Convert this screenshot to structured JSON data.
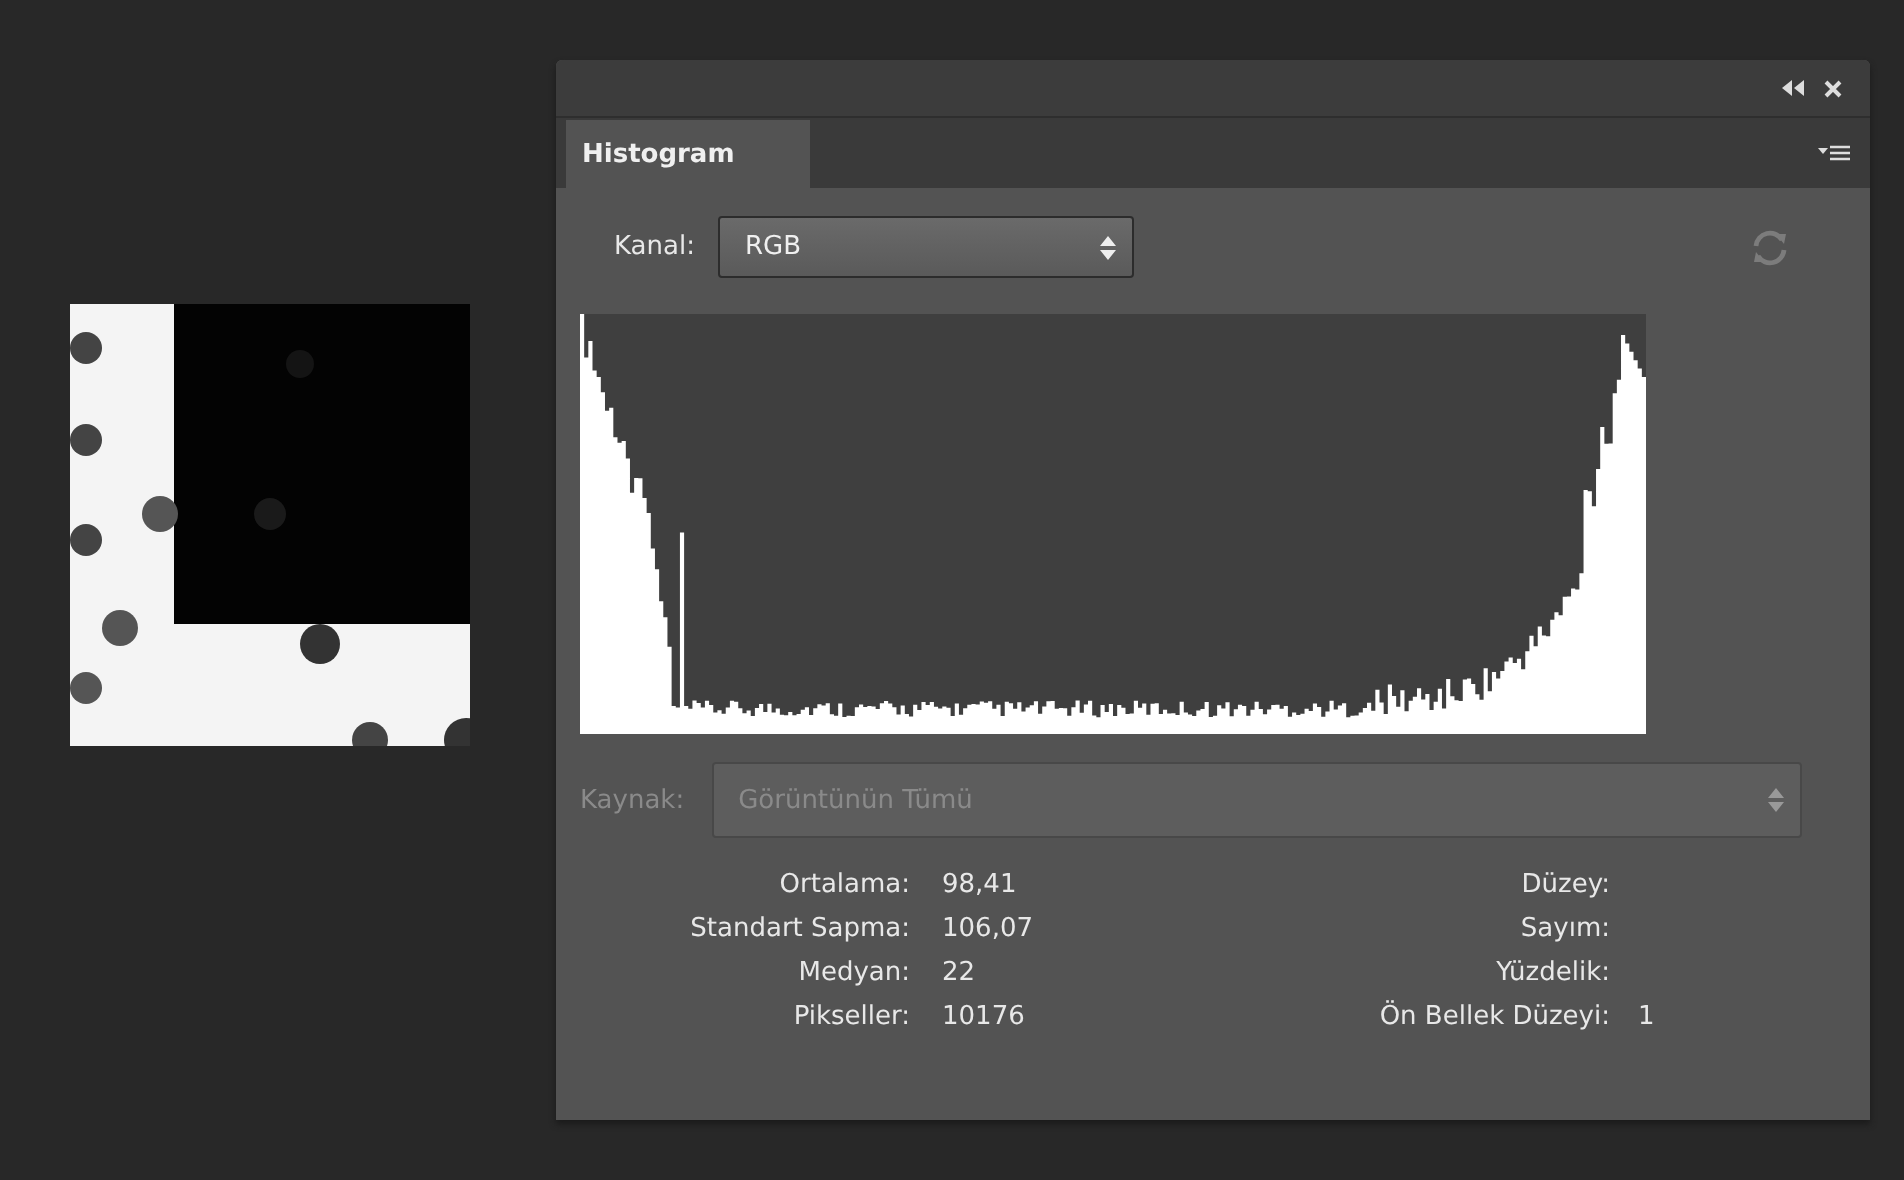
{
  "panel": {
    "tabs": [
      {
        "label": "Histogram",
        "selected": true
      }
    ],
    "channel": {
      "label": "Kanal:",
      "value": "RGB"
    },
    "source": {
      "label": "Kaynak:",
      "value": "Görüntünün Tümü",
      "disabled": true
    },
    "stats_left": [
      {
        "label": "Ortalama:",
        "value": "98,41"
      },
      {
        "label": "Standart Sapma:",
        "value": "106,07"
      },
      {
        "label": "Medyan:",
        "value": "22"
      },
      {
        "label": "Pikseller:",
        "value": "10176"
      }
    ],
    "stats_right": [
      {
        "label": "Düzey:"
      },
      {
        "label": "Sayım:"
      },
      {
        "label": "Yüzdelik:"
      },
      {
        "label": "Ön Bellek Düzeyi:",
        "value": "1"
      }
    ]
  }
}
